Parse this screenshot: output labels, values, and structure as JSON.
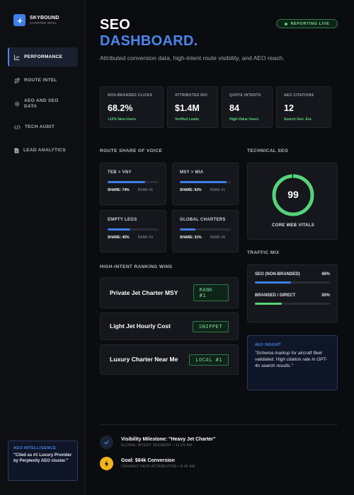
{
  "brand": {
    "name": "SKYBOUND",
    "sub": "CHARTER INTEL",
    "icon": "plane-icon"
  },
  "nav": [
    {
      "label": "PERFORMANCE",
      "icon": "chart-line-icon",
      "active": true
    },
    {
      "label": "ROUTE INTEL",
      "icon": "route-icon",
      "active": false
    },
    {
      "label": "AEO AND SEO DATA",
      "icon": "gear-icon",
      "active": false
    },
    {
      "label": "TECH AUDIT",
      "icon": "code-icon",
      "active": false
    },
    {
      "label": "LEAD ANALYTICS",
      "icon": "document-icon",
      "active": false
    }
  ],
  "aeo_intel": {
    "title": "AEO INTELLIGENCE",
    "text": "\"Cited as #1 Luxury Provider by Perplexity AEO cluster.\""
  },
  "header": {
    "title_line1": "SEO",
    "title_line2": "DASHBOARD.",
    "subtitle": "Attributed conversion data, high-intent route visibility, and AEO reach.",
    "badge": "REPORTING LIVE"
  },
  "kpis": [
    {
      "label": "NON-BRANDED CLICKS",
      "value": "68.2%",
      "note": "+12% New Users"
    },
    {
      "label": "ATTRIBUTED ROI",
      "value": "$1.4M",
      "note": "Verified Leads"
    },
    {
      "label": "QUOTE INTENTS",
      "value": "84",
      "note": "High-Value Users"
    },
    {
      "label": "AEO CITATIONS",
      "value": "12",
      "note": "Search Gen. Era"
    }
  ],
  "route_section": {
    "title": "ROUTE SHARE OF VOICE"
  },
  "routes": [
    {
      "name": "TEB > VNY",
      "share": "SHARE: 74%",
      "rank": "RANK #1",
      "share_value": 74
    },
    {
      "name": "MSY > MIA",
      "share": "SHARE: 92%",
      "rank": "RANK #1",
      "share_value": 92
    },
    {
      "name": "EMPTY LEGS",
      "share": "SHARE: 45%",
      "rank": "RANK #3",
      "share_value": 45
    },
    {
      "name": "GLOBAL CHARTERS",
      "share": "SHARE: 31%",
      "rank": "RANK #6",
      "share_value": 31
    }
  ],
  "wins_section": {
    "title": "HIGH-INTENT RANKING WINS"
  },
  "wins": [
    {
      "text": "Private Jet Charter MSY",
      "badge": "RANK #1"
    },
    {
      "text": "Light Jet Hourly Cost",
      "badge": "SNIPPET"
    },
    {
      "text": "Luxury Charter Near Me",
      "badge": "LOCAL #1"
    }
  ],
  "tech_seo": {
    "title": "TECHNICAL SEO",
    "score": "99",
    "score_value": 99,
    "label": "CORE WEB VITALS"
  },
  "traffic": {
    "title": "TRAFFIC MIX",
    "rows": [
      {
        "label": "SEO (NON-BRANDED)",
        "value": "48%",
        "fill": 48,
        "color": "#3f7ee8"
      },
      {
        "label": "BRANDED / DIRECT",
        "value": "36%",
        "fill": 36,
        "color": "#54d47a"
      }
    ]
  },
  "insight": {
    "title": "AEO INSIGHT",
    "text": "\"Schema markup for aircraft fleet validated. High citation rate in GPT-4o search results.\""
  },
  "events": [
    {
      "title": "Visibility Milestone: \"Heavy Jet Charter\"",
      "sub": "GLOBAL INTENT SEGMENT • 11:20 AM",
      "icon": "check-icon"
    },
    {
      "title": "Goal: $84k Conversion",
      "sub": "ORGANIC PATH ATTRIBUTION • 8:45 AM",
      "icon": "lightning-icon"
    }
  ],
  "colors": {
    "accent": "#3f7ee8",
    "success": "#54d47a",
    "bg": "#0b0c0f"
  }
}
